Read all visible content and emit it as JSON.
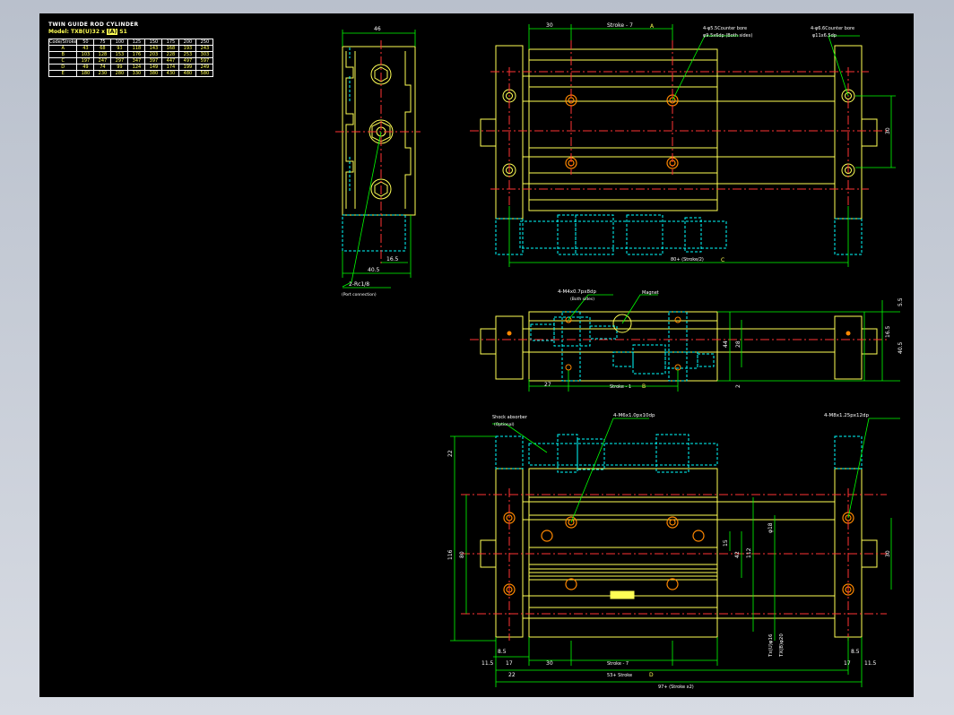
{
  "title_block": {
    "title": "TWIN GUIDE ROD CYLINDER",
    "model_prefix": "Model: TXB(U)32 x",
    "model_highlight": "(A)",
    "model_suffix": "S1"
  },
  "table": {
    "corner": "Code/Stroke",
    "strokes": [
      "50",
      "75",
      "100",
      "125",
      "150",
      "175",
      "200",
      "250"
    ],
    "rows": [
      {
        "code": "A",
        "values": [
          "43",
          "68",
          "93",
          "118",
          "143",
          "168",
          "193",
          "243"
        ]
      },
      {
        "code": "B",
        "values": [
          "103",
          "128",
          "153",
          "176",
          "203",
          "228",
          "253",
          "303"
        ]
      },
      {
        "code": "C",
        "values": [
          "197",
          "247",
          "297",
          "347",
          "397",
          "447",
          "497",
          "597"
        ]
      },
      {
        "code": "D",
        "values": [
          "49",
          "74",
          "99",
          "124",
          "149",
          "174",
          "199",
          "249"
        ]
      },
      {
        "code": "E",
        "values": [
          "180",
          "230",
          "280",
          "330",
          "380",
          "430",
          "480",
          "580"
        ]
      }
    ]
  },
  "views": {
    "side": {
      "dim_width": "46",
      "dim_port_x": "16.5",
      "dim_overall": "40.5",
      "port_label": "2-Rc1/8",
      "port_note": "(Port connection)"
    },
    "top": {
      "dim_left": "30",
      "dim_stroke": "Stroke - 7",
      "marker_a": "A",
      "cbore_label": "4-φ5.5Counter bore",
      "cbore_sub": "φ9.5x6dp (Both sides)",
      "cbore2_label": "4-φ6.6Counter bore",
      "cbore2_sub": "φ11x6.5dp",
      "dim_right": "30",
      "dim_bottom": "80+ (Stroke/2)",
      "marker_c": "C"
    },
    "middle": {
      "thread_label": "4-M4x0.7px8dp",
      "thread_sub": "(Both sides)",
      "magnet": "Magnet",
      "dim_27": "27",
      "dim_stroke": "Stroke - 1",
      "marker_b": "B",
      "dim_5_5": "5.5",
      "dim_16_5": "16.5",
      "dim_40_5": "40.5",
      "dim_44": "44",
      "dim_28": "28",
      "dim_2": "2"
    },
    "front": {
      "shock_label": "Shock absorber",
      "shock_sub": "(Optional)",
      "m6_label": "4-M6x1.0px10dp",
      "m8_label": "4-M8x1.25px12dp",
      "dim_22": "22",
      "dim_116": "116",
      "dim_80": "80",
      "dim_30": "30",
      "dim_15": "15",
      "dim_42": "42",
      "dim_112": "112",
      "dim_rod": "φ18",
      "dim_tx1": "Tx(U)φ16",
      "dim_tx2": "TX(B)φ20",
      "dim_8_5_l": "8.5",
      "dim_8_5_r": "8.5",
      "dim_11_5_l": "11.5",
      "dim_17_l": "17",
      "dim_30_b": "30",
      "dim_stroke": "Stroke - 7",
      "dim_17_r": "17",
      "dim_11_5_r": "11.5",
      "dim_22_b": "22",
      "dim_53": "53+ Stroke",
      "marker_d": "D",
      "dim_97": "97+ (Stroke x2)"
    }
  },
  "colors": {
    "background": "#000000",
    "outline": "#ffff55",
    "hidden": "#00ffff",
    "centerline": "#ff3333",
    "dimension": "#00ff00",
    "text": "#ffffff",
    "window_bg": "#c9ced8"
  }
}
